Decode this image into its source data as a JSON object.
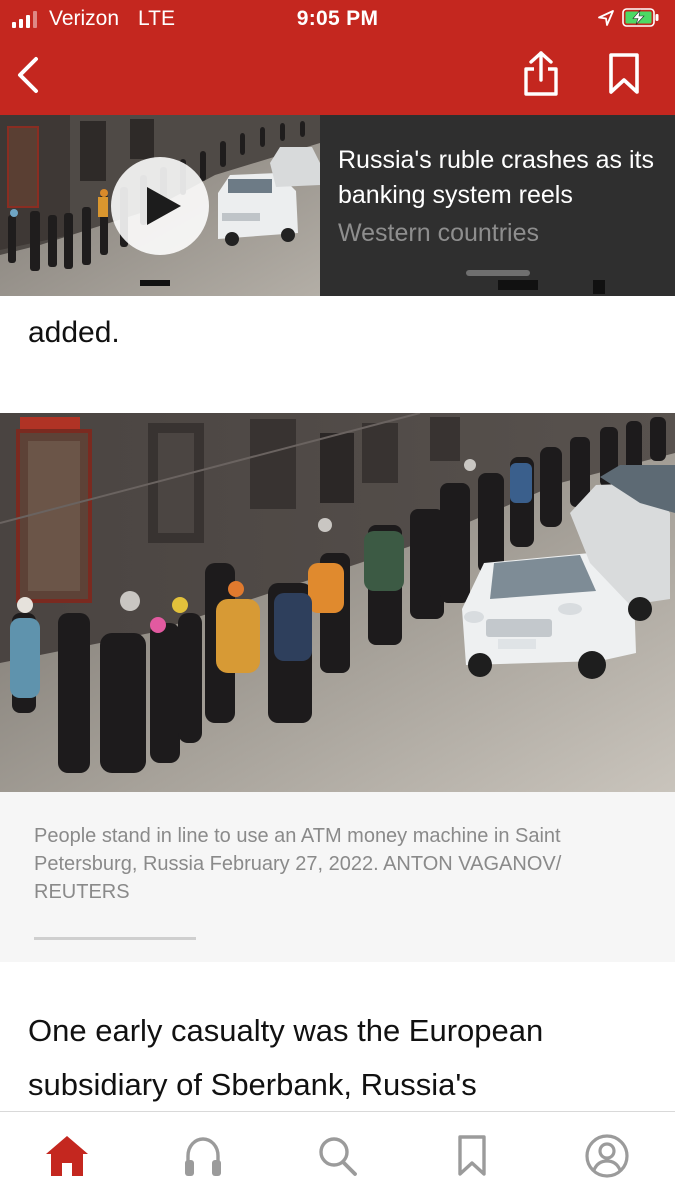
{
  "status_bar": {
    "carrier": "Verizon",
    "network": "LTE",
    "time": "9:05 PM"
  },
  "colors": {
    "brand_red": "#c4271f",
    "player_bg": "#2f2f2f",
    "caption_text": "#8a8a8a"
  },
  "nav": {
    "icons": [
      "back-icon",
      "share-icon",
      "bookmark-icon"
    ]
  },
  "mini_player": {
    "title": "Russia's ruble crashes as its banking system reels",
    "subtitle": "Western countries"
  },
  "article": {
    "partial_text": "added.",
    "photo_caption": "People stand in line to use an ATM money machine in Saint Petersburg, Russia February 27, 2022.  ANTON VAGANOV/ REUTERS",
    "body_text": "One early casualty was the European subsidiary of Sberbank, Russia's"
  },
  "tab_bar": {
    "tabs": [
      {
        "name": "home",
        "icon": "home-icon",
        "active": true
      },
      {
        "name": "audio",
        "icon": "headphones-icon",
        "active": false
      },
      {
        "name": "search",
        "icon": "search-icon",
        "active": false
      },
      {
        "name": "saved",
        "icon": "bookmark-icon",
        "active": false
      },
      {
        "name": "profile",
        "icon": "profile-icon",
        "active": false
      }
    ]
  }
}
